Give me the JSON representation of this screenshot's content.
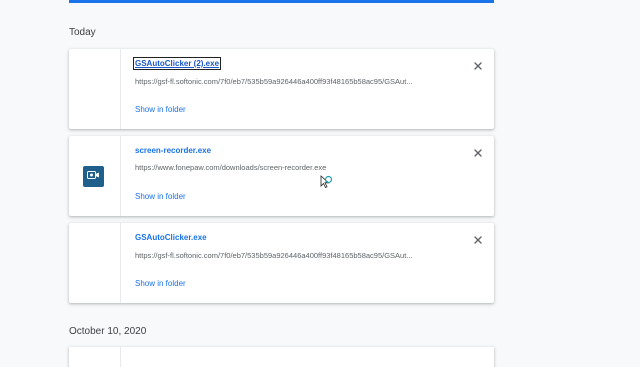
{
  "headings": {
    "today": "Today",
    "older": "October 10, 2020"
  },
  "downloads": [
    {
      "file_name": "GSAutoClicker (2).exe",
      "url": "https://gsf-fl.softonic.com/7f0/eb7/535b59a926446a400ff93f48165b58ac95/GSAut...",
      "action": "Show in folder",
      "icon": "blank-file-icon"
    },
    {
      "file_name": "screen-recorder.exe",
      "url": "https://www.fonepaw.com/downloads/screen-recorder.exe",
      "action": "Show in folder",
      "icon": "screen-recorder-app-icon"
    },
    {
      "file_name": "GSAutoClicker.exe",
      "url": "https://gsf-fl.softonic.com/7f0/eb7/535b59a926446a400ff93f48165b58ac95/GSAut...",
      "action": "Show in folder",
      "icon": "blank-file-icon"
    }
  ],
  "colors": {
    "accent": "#1a73e8",
    "background": "#f8f9fa",
    "card": "#ffffff",
    "app_icon": "#1f5f8b"
  }
}
